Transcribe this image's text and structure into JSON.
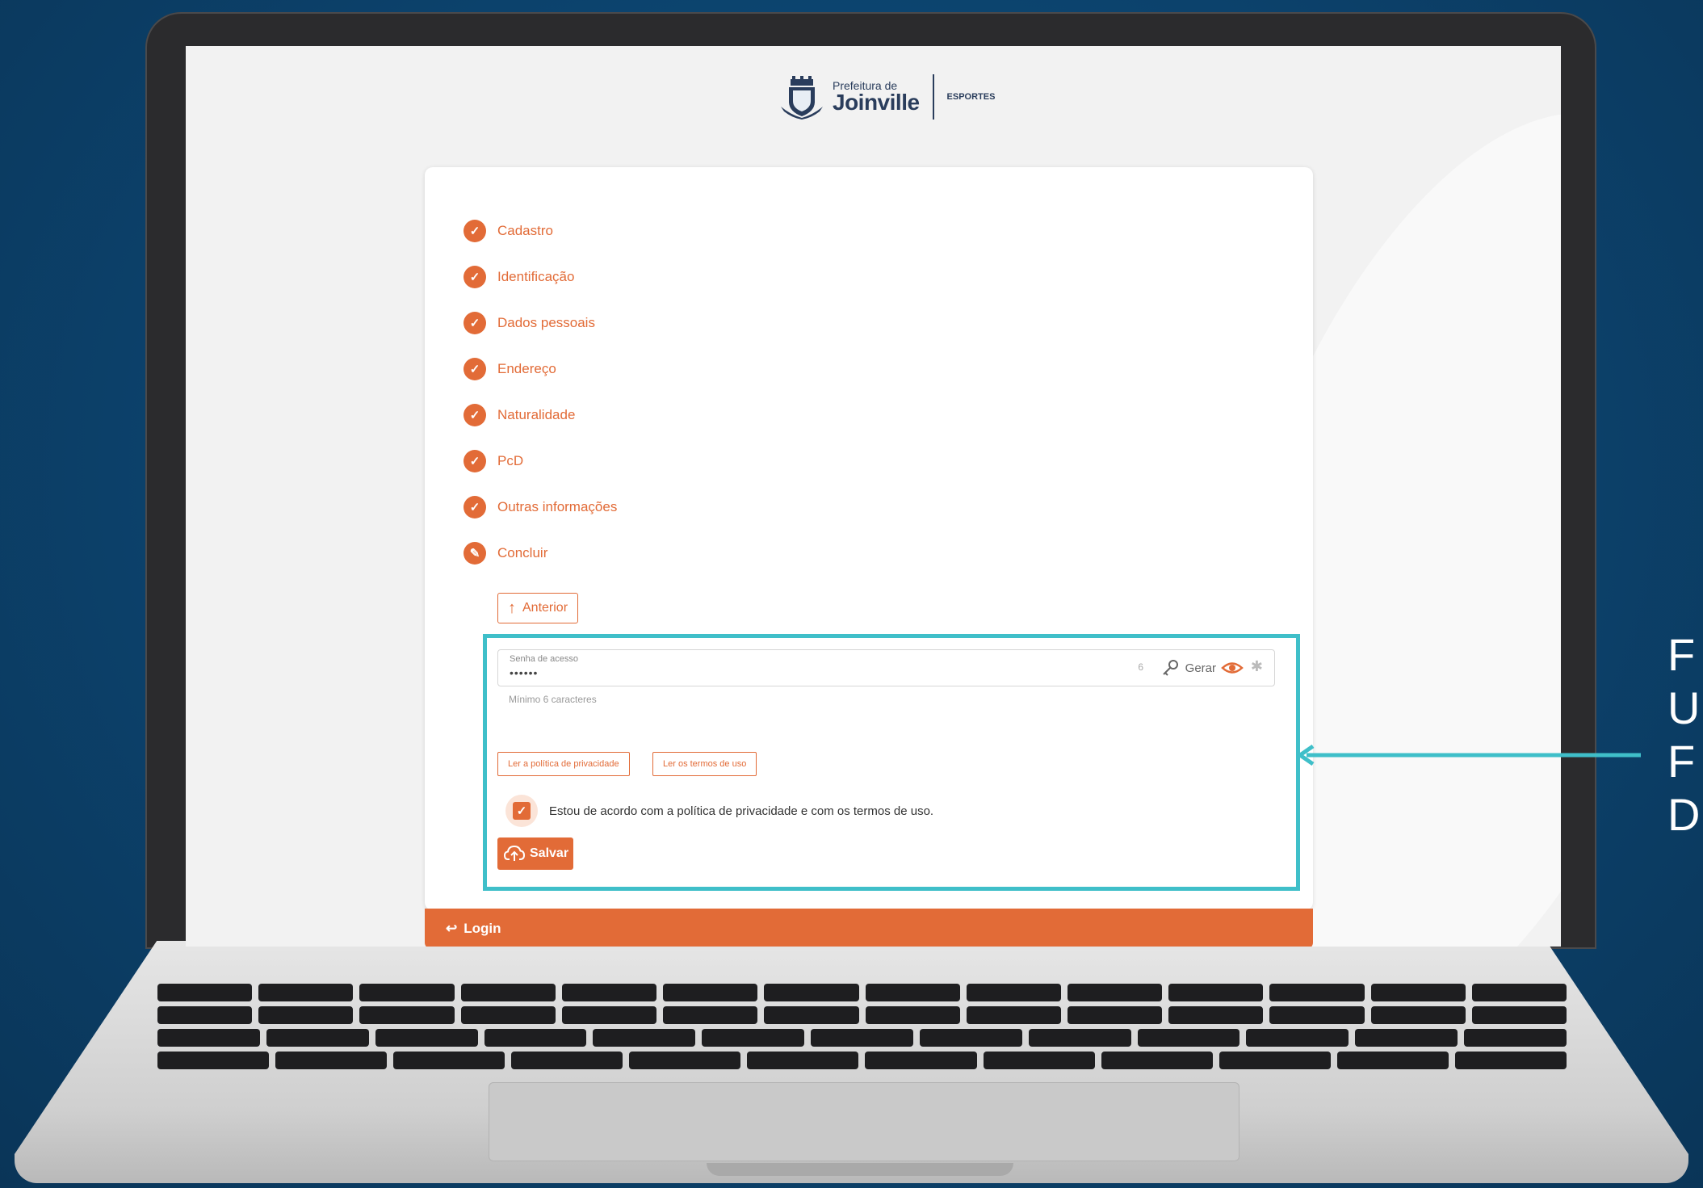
{
  "header": {
    "logo_small": "Prefeitura de",
    "logo_big": "Joinville",
    "section": "ESPORTES"
  },
  "steps": [
    {
      "label": "Cadastro",
      "icon": "check-icon"
    },
    {
      "label": "Identificação",
      "icon": "check-icon"
    },
    {
      "label": "Dados pessoais",
      "icon": "check-icon"
    },
    {
      "label": "Endereço",
      "icon": "check-icon"
    },
    {
      "label": "Naturalidade",
      "icon": "check-icon"
    },
    {
      "label": "PcD",
      "icon": "check-icon"
    },
    {
      "label": "Outras informações",
      "icon": "check-icon"
    },
    {
      "label": "Concluir",
      "icon": "pencil-icon"
    }
  ],
  "buttons": {
    "previous": "Anterior",
    "privacy": "Ler a política de privacidade",
    "terms": "Ler os termos de uso",
    "save": "Salvar"
  },
  "password": {
    "label": "Senha de acesso",
    "value": "••••••",
    "count": "6",
    "generate": "Gerar",
    "hint": "Mínimo 6 caracteres"
  },
  "agreement": {
    "text": "Estou de acordo com a política de privacidade e com os termos de uso.",
    "checked": true
  },
  "footer": {
    "login": "Login"
  },
  "annotation": {
    "text": "F\nU\nF\nD"
  },
  "colors": {
    "accent": "#e26b37",
    "highlight": "#3fbfc9",
    "background": "#0c426c"
  }
}
